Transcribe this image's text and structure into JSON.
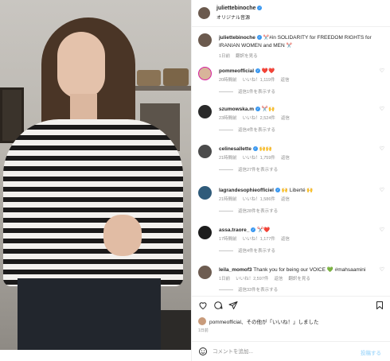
{
  "header": {
    "username": "juliettebinoche",
    "subtitle": "オリジナル音源"
  },
  "caption": {
    "username": "juliettebinoche",
    "emoji_before": "✂️",
    "text": "#in SOLIDARITY for FREEDOM RIGHTS for IRANIAN WOMEN and MEN",
    "emoji_after": "✂️",
    "time": "1日前",
    "translate": "翻訳を見る"
  },
  "comments": [
    {
      "username": "pommeofficial",
      "text": "❤️❤️",
      "time": "20時間前",
      "likes": "いいね！1,119件",
      "reply": "返信",
      "view_replies": "返信1件を表示する"
    },
    {
      "username": "szumowska.m",
      "text": "✂️🙌",
      "time": "23時間前",
      "likes": "いいね！2,524件",
      "reply": "返信",
      "view_replies": "返信4件を表示する"
    },
    {
      "username": "celinesallette",
      "text": "🙌🙌",
      "time": "21時間前",
      "likes": "いいね！1,759件",
      "reply": "返信",
      "view_replies": "返信27件を表示する"
    },
    {
      "username": "lagrandesophieofficiel",
      "text": "🙌 Liberté 🙌",
      "time": "21時間前",
      "likes": "いいね！1,586件",
      "reply": "返信",
      "view_replies": "返信28件を表示する"
    },
    {
      "username": "assa.traore_",
      "text": "✂️❤️",
      "time": "17時間前",
      "likes": "いいね！1,177件",
      "reply": "返信",
      "view_replies": "返信4件を表示する"
    },
    {
      "username": "leila_momof3",
      "text": "Thank you for being our VOICE 💚 #mahsaamini",
      "time": "1日前",
      "likes": "いいね！2,597件",
      "reply": "返信",
      "translate": "翻訳を見る",
      "view_replies": "返信33件を表示する"
    }
  ],
  "likes": {
    "text": "pommeofficial、その他が「いいね！」しました",
    "date": "1日前"
  },
  "add_comment": {
    "placeholder": "コメントを追加...",
    "post": "投稿する"
  }
}
